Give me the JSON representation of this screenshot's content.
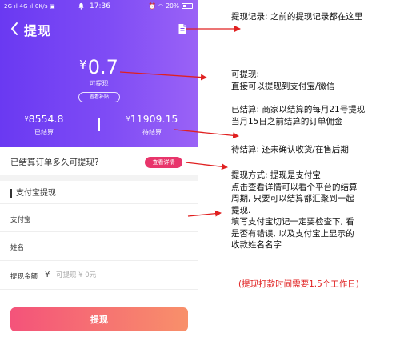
{
  "statusbar": {
    "left": "2G ıl 4G ıl 0K/s ▣",
    "time": "17:36",
    "right": "20%"
  },
  "header": {
    "title": "提现"
  },
  "balance": {
    "currency": "¥",
    "amount": "0.7",
    "label": "可提现",
    "subsidy_button": "查看补贴"
  },
  "stats": {
    "settled": {
      "currency": "¥",
      "value": "8554.8",
      "label": "已结算"
    },
    "pending": {
      "currency": "¥",
      "value": "11909.15",
      "label": "待结算"
    }
  },
  "question": {
    "text": "已结算订单多久可提现?",
    "button": "查看详情"
  },
  "form": {
    "section_title": "支付宝提现",
    "alipay_label": "支付宝",
    "alipay_value": "",
    "name_label": "姓名",
    "name_value": "",
    "amount_label": "提现金额",
    "amount_currency": "¥",
    "amount_placeholder": "可提现 ¥ 0元",
    "submit": "提现"
  },
  "annotations": {
    "record": "提现记录: 之前的提现记录都在这里",
    "withdrawable": [
      "可提现:",
      "直接可以提现到支付宝/微信"
    ],
    "settled": [
      "已结算:  商家以结算的每月21号提现",
      "当月15日之前结算的订单佣金"
    ],
    "pending": "待结算:  还未确认收货/在售后期",
    "method": [
      "提现方式: 提现是支付宝",
      "点击查看详情可以看个平台的结算",
      "周期,  只要可以结算都汇聚到一起",
      "提现.",
      "填写支付宝切记一定要检查下,  看",
      "是否有错误, 以及支付宝上显示的",
      "收款姓名名字"
    ],
    "time_note": "(提现打款时间需要1.5个工作日)"
  },
  "colors": {
    "accent_purple": "#6a39f2",
    "accent_pink": "#e8356b",
    "arrow_red": "#e02020"
  }
}
